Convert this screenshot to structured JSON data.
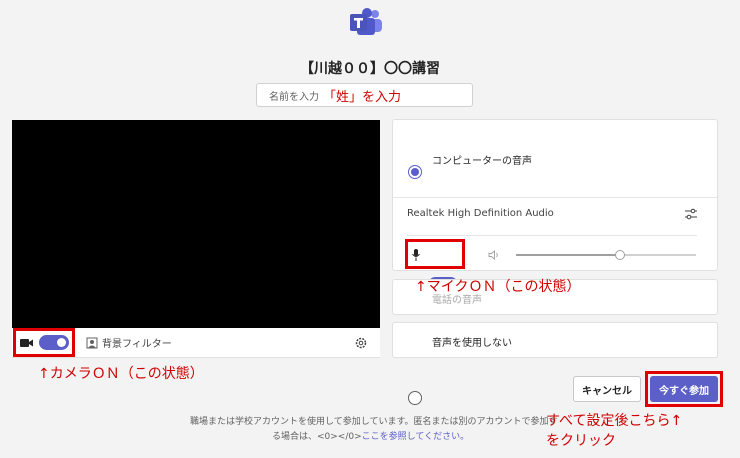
{
  "meeting": {
    "title": "【川越００】〇〇講習"
  },
  "name_field": {
    "placeholder": "名前を入力",
    "annotation": "「姓」を入力"
  },
  "video": {
    "background_filter_label": "背景フィルター",
    "camera_on": true
  },
  "audio": {
    "options": [
      {
        "label": "コンピューターの音声",
        "selected": true
      },
      {
        "label": "電話の音声",
        "selected": false
      },
      {
        "label": "音声を使用しない",
        "selected": false
      }
    ],
    "device_name": "Realtek High Definition Audio",
    "mic_on": true,
    "volume_level": 0.58
  },
  "annotations": {
    "mic": "↑マイクＯＮ（この状態）",
    "camera": "↑カメラＯＮ（この状態）",
    "join_line1": "すべて設定後こちら↑",
    "join_line2": "をクリック"
  },
  "buttons": {
    "cancel": "キャンセル",
    "join": "今すぐ参加"
  },
  "footer": {
    "line1": "職場または学校アカウントを使用して参加しています。匿名または別のアカウントで参加す",
    "line2_prefix": "る場合は、<0></0>",
    "link": "ここを参照してください。"
  },
  "colors": {
    "accent": "#5b5fc7",
    "annotation_red": "#d00000"
  }
}
